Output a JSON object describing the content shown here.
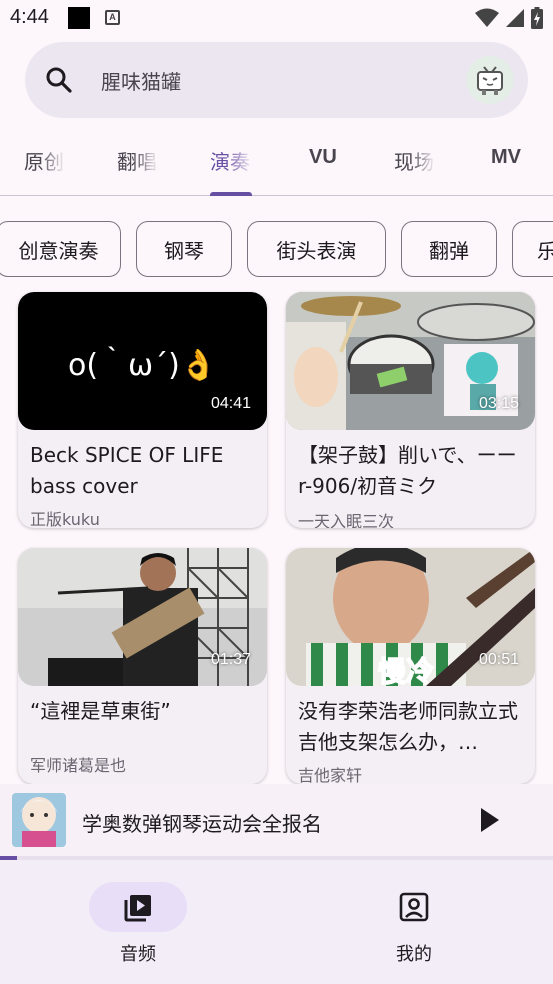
{
  "status_bar": {
    "time": "4:44"
  },
  "search": {
    "placeholder": "腥味猫罐"
  },
  "tabs": [
    {
      "label": "原创"
    },
    {
      "label": "翻唱"
    },
    {
      "label": "演奏"
    },
    {
      "label": "VU"
    },
    {
      "label": "现场"
    },
    {
      "label": "MV"
    }
  ],
  "active_tab_index": 2,
  "chips": [
    {
      "label": "创意演奏"
    },
    {
      "label": "钢琴"
    },
    {
      "label": "街头表演"
    },
    {
      "label": "翻弹"
    },
    {
      "label": "乐"
    }
  ],
  "videos": [
    {
      "title": "Beck SPICE OF LIFE bass cover",
      "author": "正版kuku",
      "duration": "04:41",
      "thumb_text": "o(｀ω´)👌"
    },
    {
      "title": "【架子鼓】削いで、ーーr-906/初音ミク",
      "author": "一天入眠三次",
      "duration": "03:15"
    },
    {
      "title": "“這裡是草東街”",
      "author": "军师诸葛是也",
      "duration": "01:37"
    },
    {
      "title": "没有李荣浩老师同款立式吉他支架怎么办，",
      "author": "吉他家轩",
      "duration": "00:51",
      "thumb_text": "慢冷"
    }
  ],
  "player": {
    "title": "学奥数弹钢琴运动会全报名",
    "progress": 0.03
  },
  "bottom_nav": [
    {
      "label": "音频",
      "active": true
    },
    {
      "label": "我的",
      "active": false
    }
  ],
  "colors": {
    "accent": "#6750a4",
    "surface": "#fdf7fb",
    "pill": "#e8def8"
  }
}
